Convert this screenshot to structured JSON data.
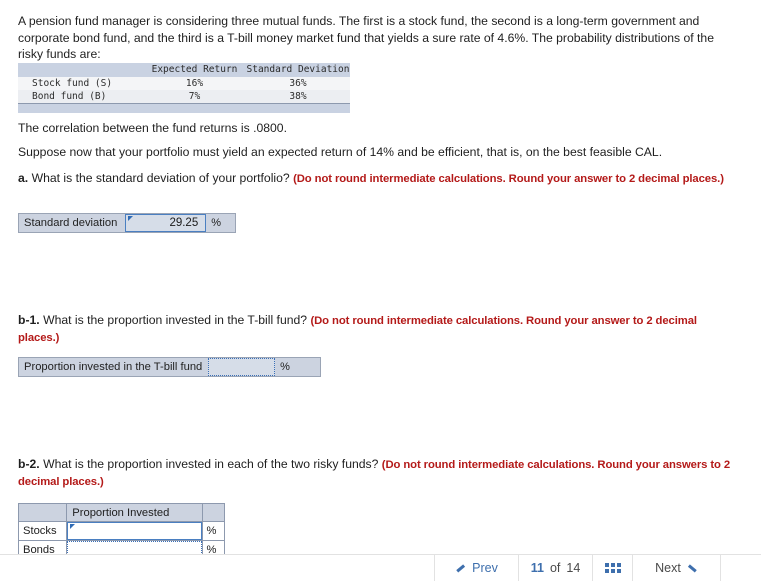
{
  "intro": {
    "paragraph": "A pension fund manager is considering three mutual funds. The first is a stock fund, the second is a long-term government and corporate bond fund, and the third is a T-bill money market fund that yields a sure rate of 4.6%. The probability distributions of the risky funds are:"
  },
  "fund_table": {
    "headers": [
      "",
      "Expected Return",
      "Standard Deviation"
    ],
    "rows": [
      {
        "name": "Stock fund (S)",
        "expected_return": "16%",
        "standard_deviation": "36%"
      },
      {
        "name": "Bond fund (B)",
        "expected_return": "7%",
        "standard_deviation": "38%"
      }
    ]
  },
  "statements": {
    "correlation": "The correlation between the fund returns is .0800.",
    "suppose": "Suppose now that your portfolio must yield an expected return of 14% and be efficient, that is, on the best feasible CAL."
  },
  "questions": {
    "a": {
      "label": "a.",
      "text": "What is the standard deviation of your portfolio?",
      "hint": "(Do not round intermediate calculations. Round your answer to 2 decimal places.)",
      "answer": {
        "label": "Standard deviation",
        "value": "29.25",
        "unit": "%"
      }
    },
    "b1": {
      "label": "b-1.",
      "text": "What is the proportion invested in the T-bill fund?",
      "hint": "(Do not round intermediate calculations. Round your answer to 2 decimal places.)",
      "answer": {
        "label": "Proportion invested in the T-bill fund",
        "value": "",
        "unit": "%"
      }
    },
    "b2": {
      "label": "b-2.",
      "text": "What is the proportion invested in each of the two risky funds?",
      "hint": "(Do not round intermediate calculations. Round your answers to 2 decimal places.)",
      "table": {
        "headers": [
          "",
          "Proportion Invested",
          ""
        ],
        "rows": [
          {
            "name": "Stocks",
            "value": "",
            "unit": "%"
          },
          {
            "name": "Bonds",
            "value": "",
            "unit": "%"
          }
        ]
      }
    }
  },
  "nav": {
    "prev_label": "Prev",
    "page_current": "11",
    "page_of": "of",
    "page_total": "14",
    "next_label": "Next"
  }
}
